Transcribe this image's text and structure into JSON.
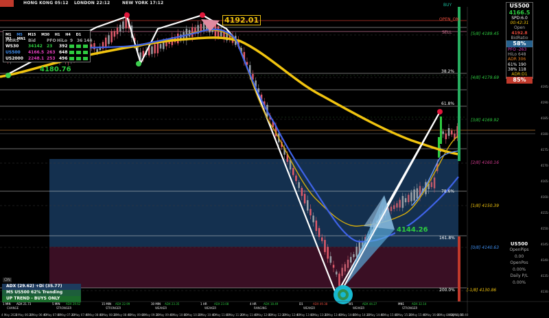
{
  "sessions": {
    "hong_kong": "HONG KONG 05:12",
    "london": "LONDON  22:12",
    "new_york": "NEW YORK 17:12"
  },
  "colors": {
    "bull": "#2ecc40",
    "bear": "#e74c3c",
    "ma_yellow": "#f1c40f",
    "ma_blue": "#3f63e8",
    "zone_blue": "#14304f",
    "zone_red": "#3a0f24"
  },
  "labels": {
    "buy": "BUY",
    "open_on": "OPEN_ON",
    "sell": "SELL",
    "price_top": "4192.01",
    "price_left": "4180.76",
    "price_mid": "4144.26",
    "on_tag": "ON"
  },
  "fib": {
    "f382": "38.2%",
    "f618": "61.8%",
    "f786": "78.6%",
    "f1618": "161.8%",
    "f200": "200.0%"
  },
  "murrey": {
    "m58": "[5/8]  4189.45",
    "m48": "[4/8]  4179.69",
    "m38": "[3/8]  4169.92",
    "m28": "[2/8]  4160.16",
    "m18": "[1/8]  4150.39",
    "m08": "[0/8]  4140.63",
    "mm18": "[-1/8]  4130.86"
  },
  "pairs": {
    "header": [
      "M1",
      "M5",
      "M15",
      "M30",
      "H1",
      "H4",
      "D1",
      "W1",
      "MN1"
    ],
    "subheader": [
      "PAIRS",
      "Bid",
      "PFO",
      "HiLo",
      "9",
      "36",
      "144"
    ],
    "rows": [
      {
        "name": "WS30",
        "bid": "34142",
        "pfo": "23",
        "hilo": "392",
        "color": "#2ecc40"
      },
      {
        "name": "US500",
        "bid": "4166.5",
        "pfo": "263",
        "hilo": "648",
        "color": "#3f8ff0"
      },
      {
        "name": "US2000",
        "bid": "2248.1",
        "pfo": "253",
        "hilo": "496",
        "color": "#e63fbf"
      }
    ]
  },
  "right_panel": {
    "symbol": "US500",
    "price": "4166.5",
    "spd": "SPD:6.0",
    "timer": "00:42:31",
    "open_label": "Open",
    "open_val": "4192.8",
    "bidratio": "BidRatio",
    "ratio_pct": "58%",
    "pfo": "PFO    -263",
    "hilo": "HiLo    648",
    "adr": "ADR    306",
    "adr_pct1": "61%    190",
    "adr_pct2": "38%    118",
    "adr_d1": "ADR:D1",
    "adr_d1_pct": "85%"
  },
  "right_panel2": {
    "symbol": "US500",
    "openpips": "OpenPips",
    "openpips_val": "0.00",
    "openpos": "OpenPos",
    "openpos_val": "0.00%",
    "daily": "Daily P/L",
    "daily_val": "0.00%"
  },
  "adx": {
    "line1": "ADX (29.62)  +Di (35.77)",
    "line2": "M5 US500 62% Trending",
    "line3": "UP TREND - BUYS ONLY"
  },
  "strip": [
    {
      "tf": "1 MIN",
      "adx": "ADX 21.73",
      "state": "CHANGE"
    },
    {
      "tf": "5 MIN",
      "adx": "ADX 29.62",
      "state": "STRONGER"
    },
    {
      "tf": "15 MIN",
      "adx": "ADX 22.99",
      "state": "STRONGER"
    },
    {
      "tf": "30 MIN",
      "adx": "ADX 23.35",
      "state": "WEAKER"
    },
    {
      "tf": "1 HR",
      "adx": "ADX 23.08",
      "state": "WEAKER"
    },
    {
      "tf": "4 HR",
      "adx": "ADX 18.49",
      "state": "RANGING"
    },
    {
      "tf": "D1",
      "adx": "ADX 49.38",
      "state": "WEAKER"
    },
    {
      "tf": "W1",
      "adx": "ADX 44.27",
      "state": "WEAKER"
    },
    {
      "tf": "MN1",
      "adx": "ADX 32.14",
      "state": "STRONGER"
    }
  ],
  "time_axis": [
    "4 May 2022",
    "4 May 06:20",
    "4 May 06:40",
    "4 May 07:00",
    "4 May 07:20",
    "4 May 07:40",
    "4 May 08:00",
    "4 May 08:20",
    "4 May 08:40",
    "4 May 09:00",
    "4 May 09:20",
    "4 May 09:40",
    "4 May 10:00",
    "4 May 10:20",
    "4 May 10:40",
    "4 May 11:00",
    "4 May 11:20",
    "4 May 11:40",
    "4 May 12:00",
    "4 May 12:20",
    "4 May 12:40",
    "4 May 13:00",
    "4 May 13:20",
    "4 May 13:40",
    "4 May 14:00",
    "4 May 14:20",
    "4 May 14:40",
    "4 May 15:00",
    "4 May 15:20",
    "4 May 15:40",
    "4 May 16:00",
    "4 May 16:20",
    "4 May 16:40",
    "4 May 17:00"
  ],
  "price_axis": [
    "4195.00",
    "4190.00",
    "4185.00",
    "4180.00",
    "4175.00",
    "4170.00",
    "4165.00",
    "4160.00",
    "4155.00",
    "4150.00",
    "4145.00",
    "4140.00",
    "4135.00",
    "4130.00"
  ]
}
